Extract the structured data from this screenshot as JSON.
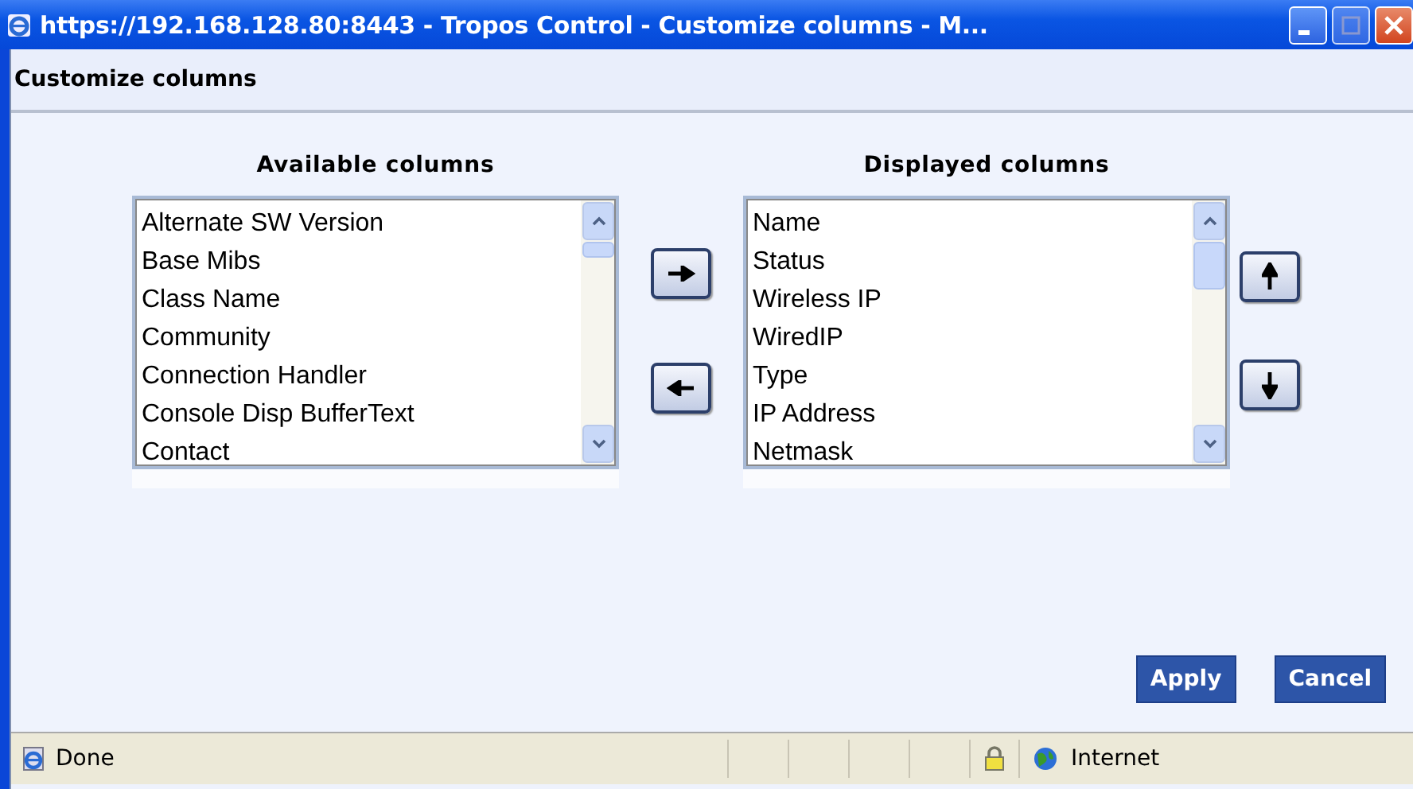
{
  "window": {
    "title": "https://192.168.128.80:8443 - Tropos Control - Customize columns - M..."
  },
  "dialog": {
    "heading": "Customize columns"
  },
  "available": {
    "label": "Available columns",
    "items": [
      "Alternate SW Version",
      "Base Mibs",
      "Class Name",
      "Community",
      "Connection Handler",
      "Console Disp BufferText",
      "Contact"
    ]
  },
  "displayed": {
    "label": "Displayed columns",
    "items": [
      "Name",
      "Status",
      "Wireless IP",
      "WiredIP",
      "Type",
      "IP Address",
      "Netmask"
    ]
  },
  "buttons": [
    "Apply",
    "Cancel"
  ],
  "status_bar": {
    "text": "Done",
    "zone": "Internet"
  }
}
